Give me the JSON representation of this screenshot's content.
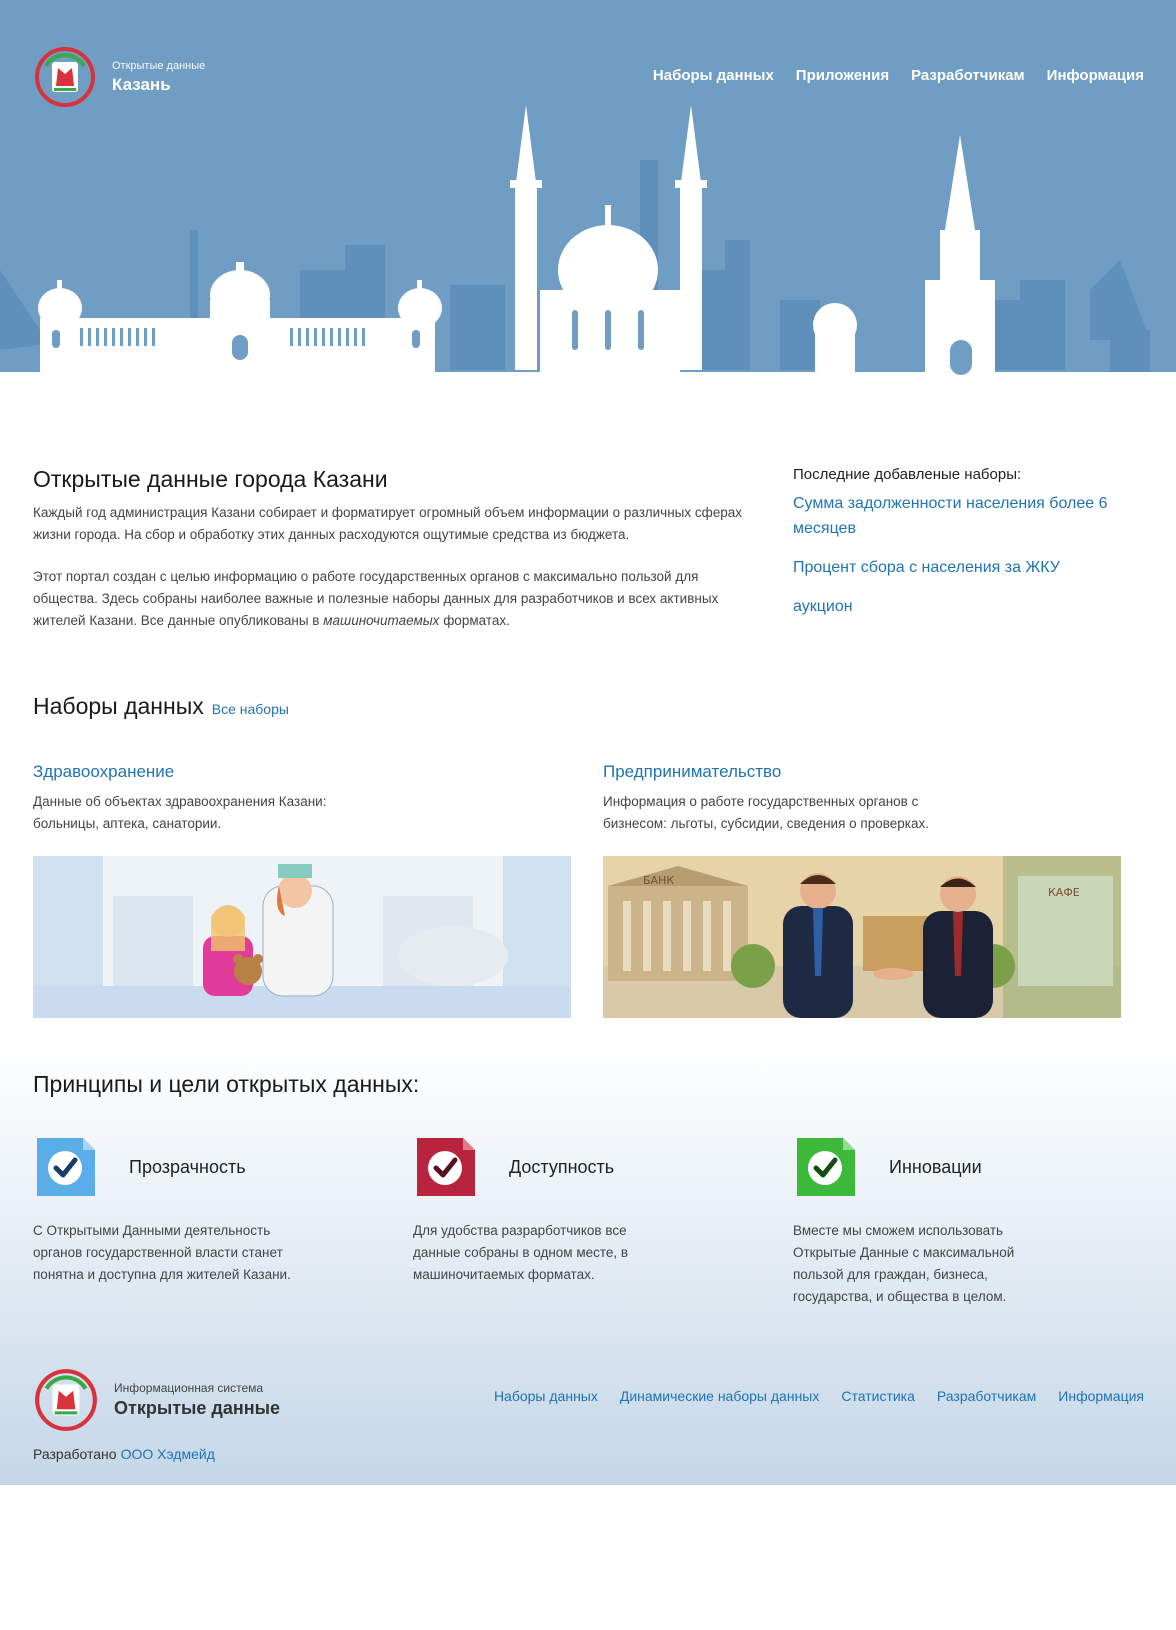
{
  "header": {
    "logo_small": "Открытые данные",
    "logo_big": "Казань",
    "nav": [
      "Наборы данных",
      "Приложения",
      "Разработчикам",
      "Информация"
    ]
  },
  "intro": {
    "title": "Открытые данные города Казани",
    "p1": "Каждый год администрация Казани собирает и форматирует огромный объем информации о различных сферах жизни города. На сбор и обработку этих данных расходуются ощутимые средства из бюджета.",
    "p2_start": "Этот портал создан с целью информацию о работе государственных органов с максимально пользой для общества. Здесь собраны наиболее важные и полезные наборы данных для разработчиков и всех активных жителей Казани. Все данные опубликованы в",
    "p2_em": "машиночитаемых",
    "p2_end": "форматах."
  },
  "recent": {
    "title": "Последние добавленые наборы:",
    "items": [
      "Сумма задолженности населения более 6 месяцев",
      "Процент сбора с населения за ЖКУ",
      "аукцион"
    ]
  },
  "datasets": {
    "title": "Наборы данных",
    "all_link": "Все наборы",
    "cards": [
      {
        "title": "Здравоохранение",
        "desc": "Данные об объектах здравоохранения Казани: больницы, аптека, санатории."
      },
      {
        "title": "Предпринимательство",
        "desc": "Информация о работе государственных органов с бизнесом: льготы, субсидии, сведения о проверках."
      }
    ],
    "illustration_labels": {
      "bank": "БАНК",
      "cafe": "КАФЕ"
    }
  },
  "principles": {
    "title": "Принципы и цели открытых данных:",
    "items": [
      {
        "name": "Прозрачность",
        "text": "С Открытыми Данными деятельность органов государственной власти станет понятна и доступна для жителей Казани.",
        "color": "#5aaee8"
      },
      {
        "name": "Доступность",
        "text": "Для удобства разрарботчиков все данные собраны в одном месте, в машиночитаемых форматах.",
        "color": "#b8233e"
      },
      {
        "name": "Инновации",
        "text": "Вместе мы сможем использовать Открытые Данные с максимальной пользой для граждан, бизнеса, государства, и общества в целом.",
        "color": "#3cb83a"
      }
    ]
  },
  "footer": {
    "logo_small": "Информационная система",
    "logo_big": "Открытые данные",
    "nav": [
      "Наборы данных",
      "Динамические наборы данных",
      "Статистика",
      "Разработчикам",
      "Информация"
    ],
    "credit_prefix": "Разработано",
    "credit_link": "ООО Хэдмейд"
  },
  "colors": {
    "sky": "#6f9dc4",
    "skyline_back": "#5f8fbb",
    "link": "#1f74b3"
  }
}
